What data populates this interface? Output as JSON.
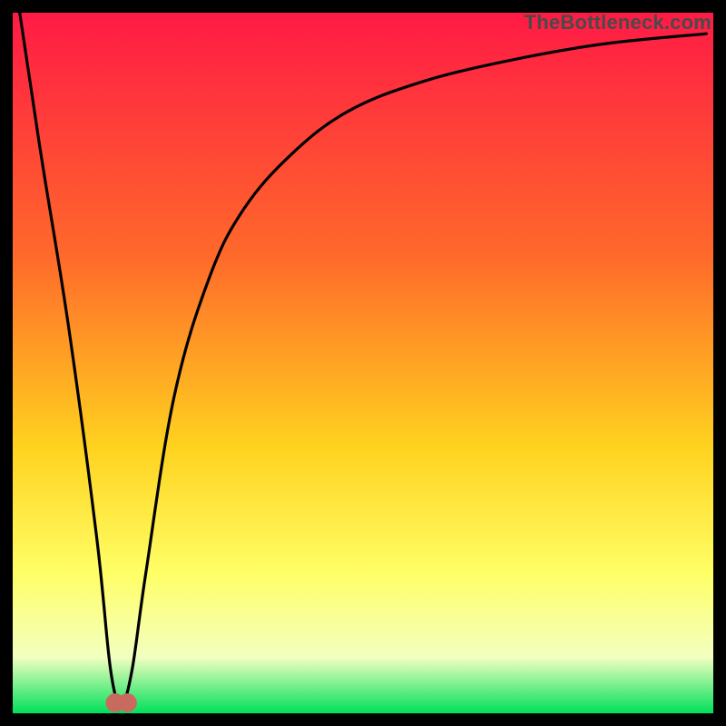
{
  "watermark": "TheBottleneck.com",
  "colors": {
    "background": "#000000",
    "gradient_top": "#ff1a45",
    "gradient_mid1": "#ff6a2a",
    "gradient_mid2": "#ffd21f",
    "gradient_mid3": "#ffff66",
    "gradient_mid4": "#f3ffc0",
    "gradient_bottom": "#00e05a",
    "curve": "#000000",
    "marker": "#c96a5e"
  },
  "chart_data": {
    "type": "line",
    "title": "",
    "xlabel": "",
    "ylabel": "",
    "x_range": [
      0,
      100
    ],
    "y_range": [
      0,
      100
    ],
    "series": [
      {
        "name": "bottleneck-curve",
        "note": "V-shaped bottleneck curve; y-values read off the unlabeled chart area (0 = bottom / green, 100 = top / red)",
        "x": [
          1,
          4,
          8,
          12,
          14,
          15.5,
          17,
          19,
          23,
          28,
          33,
          40,
          48,
          58,
          70,
          84,
          99
        ],
        "y": [
          100,
          80,
          55,
          25,
          6,
          1.5,
          6,
          20,
          45,
          62,
          72,
          80,
          86,
          90,
          93,
          95.5,
          97
        ]
      }
    ],
    "marker": {
      "name": "minimum-lobe",
      "shape": "rounded-double-lobe",
      "center_x": 15.5,
      "center_y": 1.5,
      "approx_width": 4
    },
    "legend": null,
    "grid": false
  }
}
